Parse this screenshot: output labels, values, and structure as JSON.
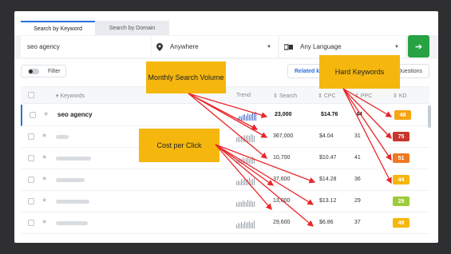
{
  "tabs": {
    "active": "Search by Keyword",
    "inactive": "Search by Domain"
  },
  "search": {
    "keyword": "seo agency",
    "location": "Anywhere",
    "language": "Any Language",
    "go_icon": "arrow-right-icon"
  },
  "toolbar": {
    "filter": "Filter",
    "related": "Related keywords",
    "questions": "Questions"
  },
  "table": {
    "headers": {
      "keywords": "Keywords",
      "trend": "Trend",
      "search": "Search",
      "cpc": "CPC",
      "ppc": "PPC",
      "kd": "KD"
    },
    "rows": [
      {
        "keyword": "seo agency",
        "search": "23,000",
        "cpc": "$14.76",
        "ppc": "44",
        "kd": "48",
        "kd_color": "#f5a413"
      },
      {
        "keyword": "",
        "search": "367,000",
        "cpc": "$4.04",
        "ppc": "31",
        "kd": "75",
        "kd_color": "#c8372d"
      },
      {
        "keyword": "",
        "search": "10,700",
        "cpc": "$10.47",
        "ppc": "41",
        "kd": "51",
        "kd_color": "#ef7a22"
      },
      {
        "keyword": "",
        "search": "37,600",
        "cpc": "$14.28",
        "ppc": "36",
        "kd": "44",
        "kd_color": "#f5b70e"
      },
      {
        "keyword": "",
        "search": "13,000",
        "cpc": "$13.12",
        "ppc": "29",
        "kd": "29",
        "kd_color": "#9ccc3a"
      },
      {
        "keyword": "",
        "search": "29,600",
        "cpc": "$6.86",
        "ppc": "37",
        "kd": "49",
        "kd_color": "#f5b70e"
      }
    ]
  },
  "callouts": {
    "monthly": "Monthly Search Volume",
    "cpc": "Cost per Click",
    "hard": "Hard Keywords"
  },
  "colors": {
    "accent": "#2d6fdc",
    "go": "#27a344",
    "callout": "#f5b70e",
    "arrow": "#e8262a"
  }
}
